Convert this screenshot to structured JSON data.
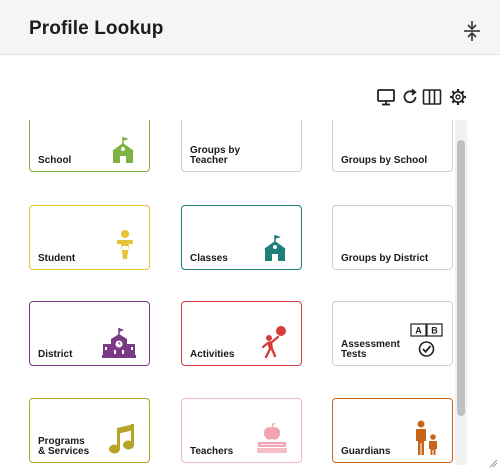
{
  "header": {
    "title": "Profile Lookup"
  },
  "toolbar": {
    "icons": [
      "monitor-icon",
      "refresh-icon",
      "columns-icon",
      "gear-icon"
    ]
  },
  "tiles": [
    {
      "label": "School",
      "color": "#7cb342",
      "icon": "school-building-icon"
    },
    {
      "label": "Groups by\nTeacher",
      "color": "#cfcfcf",
      "icon": ""
    },
    {
      "label": "Groups by School",
      "color": "#cfcfcf",
      "icon": ""
    },
    {
      "label": "Student",
      "color": "#e5c23a",
      "icon": "student-figure-icon"
    },
    {
      "label": "Classes",
      "color": "#1f7f7a",
      "icon": "school-building-icon"
    },
    {
      "label": "Groups by District",
      "color": "#cfcfcf",
      "icon": ""
    },
    {
      "label": "District",
      "color": "#7a3b86",
      "icon": "district-building-icon"
    },
    {
      "label": "Activities",
      "color": "#d83b3b",
      "icon": "ball-player-icon"
    },
    {
      "label": "Assessment\nTests",
      "color": "#cfcfcf",
      "icon": "assessment-ab-check-icon"
    },
    {
      "label": "Programs\n& Services",
      "color": "#b5a32a",
      "icon": "music-note-icon"
    },
    {
      "label": "Teachers",
      "color": "#f4b8c2",
      "icon": "apple-books-icon"
    },
    {
      "label": "Guardians",
      "color": "#c8641a",
      "icon": "parent-child-icon"
    }
  ],
  "assessment_icon_text": {
    "a": "A",
    "b": "B"
  }
}
